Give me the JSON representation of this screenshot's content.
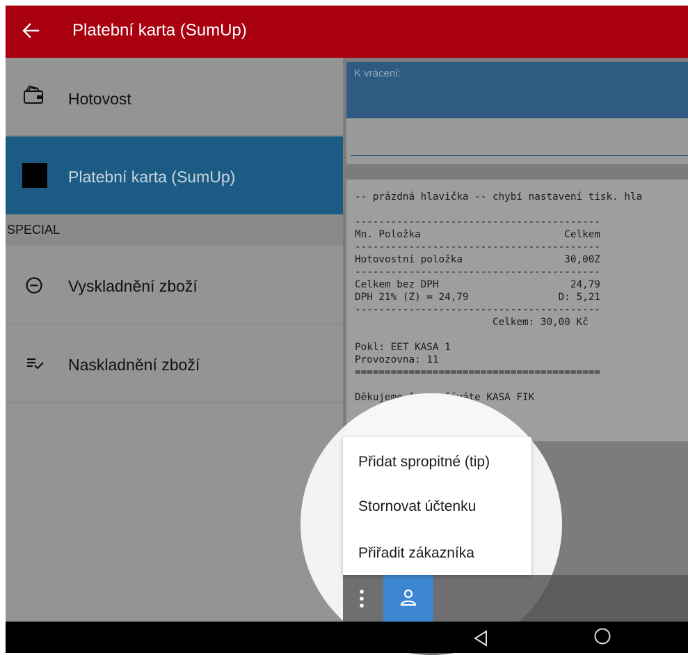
{
  "app_bar": {
    "title": "Platební karta (SumUp)",
    "color": "#a8000e"
  },
  "sidebar": {
    "items": [
      {
        "label": "Hotovost",
        "icon": "wallet-icon"
      },
      {
        "label": "Platební karta (SumUp)",
        "icon": "card-icon",
        "selected": true
      }
    ],
    "special_header": "SPECIAL",
    "special_items": [
      {
        "label": "Vyskladnění zboží",
        "icon": "minus-circle-icon"
      },
      {
        "label": "Naskladnění zboží",
        "icon": "playlist-check-icon"
      }
    ]
  },
  "return_field": {
    "label": "K vrácení:",
    "value": ""
  },
  "receipt": {
    "text": "-- prázdná hlavička -- chybí nastavení tisk. hla\n\n-----------------------------------------\nMn. Položka                        Celkem\n-----------------------------------------\nHotovostní položka                 30,00Z\n-----------------------------------------\nCelkem bez DPH                      24,79\nDPH 21% (Z) = 24,79               D: 5,21\n-----------------------------------------\n                       Celkem: 30,00 Kč\n\nPokl: EET KASA 1\nProvozovna: 11\n=========================================\n\nDěkujeme že používáte KASA FIK"
  },
  "popup_menu": {
    "items": [
      {
        "label": "Přidat spropitné (tip)"
      },
      {
        "label": "Stornovat účtenku"
      },
      {
        "label": "Přiřadit zákazníka"
      }
    ]
  },
  "bottom_bar": {
    "more_icon": "more-vert-icon",
    "customer_icon": "person-icon",
    "accent": "#3d86d2"
  },
  "system_nav": {
    "back_icon": "nav-back-icon",
    "home_icon": "nav-home-icon"
  }
}
